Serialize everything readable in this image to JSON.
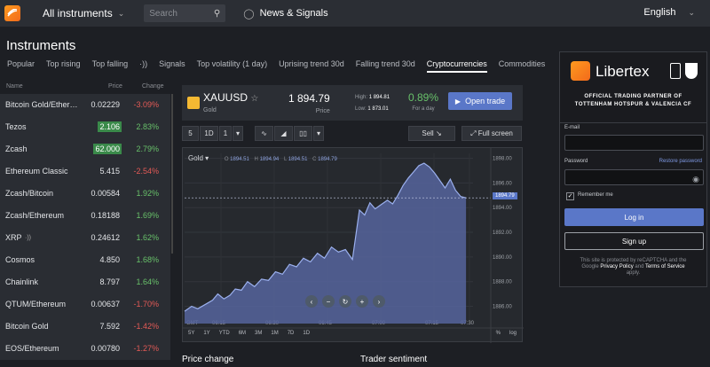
{
  "nav": {
    "all_instruments": "All instruments",
    "search_placeholder": "Search",
    "news": "News & Signals",
    "language": "English"
  },
  "page_title": "Instruments",
  "tabs": [
    "Popular",
    "Top rising",
    "Top falling",
    "Signals",
    "Top volatility (1 day)",
    "Uprising trend 30d",
    "Falling trend 30d",
    "Cryptocurrencies",
    "Commodities"
  ],
  "active_tab": "Cryptocurrencies",
  "list_header": {
    "name": "Name",
    "price": "Price",
    "change": "Change"
  },
  "instruments": [
    {
      "name": "Bitcoin Gold/Ether…",
      "price": "0.02229",
      "change": "-3.09%",
      "dir": "neg",
      "hl": false
    },
    {
      "name": "Tezos",
      "price": "2.106",
      "change": "2.83%",
      "dir": "pos",
      "hl": true
    },
    {
      "name": "Zcash",
      "price": "62.000",
      "change": "2.79%",
      "dir": "pos",
      "hl": true
    },
    {
      "name": "Ethereum Classic",
      "price": "5.415",
      "change": "-2.54%",
      "dir": "neg",
      "hl": false
    },
    {
      "name": "Zcash/Bitcoin",
      "price": "0.00584",
      "change": "1.92%",
      "dir": "pos",
      "hl": false
    },
    {
      "name": "Zcash/Ethereum",
      "price": "0.18188",
      "change": "1.69%",
      "dir": "pos",
      "hl": false
    },
    {
      "name": "XRP",
      "price": "0.24612",
      "change": "1.62%",
      "dir": "pos",
      "hl": false
    },
    {
      "name": "Cosmos",
      "price": "4.850",
      "change": "1.68%",
      "dir": "pos",
      "hl": false
    },
    {
      "name": "Chainlink",
      "price": "8.797",
      "change": "1.64%",
      "dir": "pos",
      "hl": false
    },
    {
      "name": "QTUM/Ethereum",
      "price": "0.00637",
      "change": "-1.70%",
      "dir": "neg",
      "hl": false
    },
    {
      "name": "Bitcoin Gold",
      "price": "7.592",
      "change": "-1.42%",
      "dir": "neg",
      "hl": false
    },
    {
      "name": "EOS/Ethereum",
      "price": "0.00780",
      "change": "-1.27%",
      "dir": "neg",
      "hl": false
    }
  ],
  "quote": {
    "symbol": "XAUUSD",
    "subtitle": "Gold",
    "price": "1 894.79",
    "price_label": "Price",
    "high_label": "High:",
    "high": "1 894.81",
    "low_label": "Low:",
    "low": "1 873.01",
    "change": "0.89%",
    "change_label": "For a day",
    "open_trade": "Open trade"
  },
  "toolbar": {
    "interval1": "5",
    "interval2": "1D",
    "interval3": "1",
    "sell": "Sell",
    "fullscreen": "Full screen"
  },
  "ohlc": {
    "name": "Gold",
    "o_label": "O",
    "o": "1894.51",
    "h_label": "H",
    "h": "1894.94",
    "l_label": "L",
    "l": "1894.51",
    "c_label": "C",
    "c": "1894.79"
  },
  "current_tag": "1894.79",
  "ranges": [
    "5Y",
    "1Y",
    "YTD",
    "6M",
    "3M",
    "1M",
    "7D",
    "1D"
  ],
  "range_right": [
    "%",
    "log"
  ],
  "gmt": "GMT",
  "chart_data": {
    "type": "area",
    "x": [
      "06:15",
      "06:30",
      "06:45",
      "07:00",
      "07:15",
      "07:30"
    ],
    "y_ticks": [
      1886,
      1888,
      1890,
      1892,
      1894,
      1896,
      1898
    ],
    "ylim": [
      1884.6,
      1898.4
    ],
    "xrange": [
      0,
      330
    ],
    "series": [
      {
        "values": [
          [
            0,
            1885.6
          ],
          [
            8,
            1886.0
          ],
          [
            15,
            1885.8
          ],
          [
            25,
            1886.2
          ],
          [
            32,
            1886.5
          ],
          [
            38,
            1887.0
          ],
          [
            45,
            1886.6
          ],
          [
            52,
            1886.9
          ],
          [
            58,
            1887.4
          ],
          [
            65,
            1887.3
          ],
          [
            72,
            1888.0
          ],
          [
            80,
            1887.6
          ],
          [
            88,
            1888.2
          ],
          [
            96,
            1888.1
          ],
          [
            104,
            1888.8
          ],
          [
            112,
            1888.6
          ],
          [
            120,
            1889.4
          ],
          [
            128,
            1889.2
          ],
          [
            136,
            1889.9
          ],
          [
            144,
            1889.6
          ],
          [
            152,
            1890.3
          ],
          [
            160,
            1889.9
          ],
          [
            168,
            1890.8
          ],
          [
            176,
            1890.4
          ],
          [
            184,
            1890.6
          ],
          [
            192,
            1889.8
          ],
          [
            200,
            1893.8
          ],
          [
            206,
            1893.4
          ],
          [
            212,
            1894.4
          ],
          [
            218,
            1893.9
          ],
          [
            224,
            1894.2
          ],
          [
            232,
            1894.6
          ],
          [
            238,
            1894.3
          ],
          [
            244,
            1895.0
          ],
          [
            250,
            1895.8
          ],
          [
            256,
            1896.4
          ],
          [
            262,
            1896.9
          ],
          [
            268,
            1897.4
          ],
          [
            274,
            1897.6
          ],
          [
            280,
            1897.3
          ],
          [
            286,
            1896.8
          ],
          [
            292,
            1896.2
          ],
          [
            298,
            1895.6
          ],
          [
            304,
            1896.3
          ],
          [
            310,
            1895.4
          ],
          [
            316,
            1894.9
          ],
          [
            322,
            1894.79
          ]
        ]
      }
    ],
    "last_value": 1894.79
  },
  "price_change": "Price change",
  "trader_sentiment": "Trader sentiment",
  "login_panel": {
    "brand": "Libertex",
    "partner_line1": "OFFICIAL TRADING PARTNER OF",
    "partner_line2": "TOTTENHAM HOTSPUR & VALENCIA CF",
    "email_label": "E-mail",
    "password_label": "Password",
    "restore": "Restore password",
    "remember": "Remember me",
    "login": "Log in",
    "signup": "Sign up",
    "captcha_1": "This site is protected by reCAPTCHA and the",
    "captcha_2": "Google",
    "privacy": "Privacy Policy",
    "and": "and",
    "terms": "Terms of Service",
    "apply": "apply."
  }
}
